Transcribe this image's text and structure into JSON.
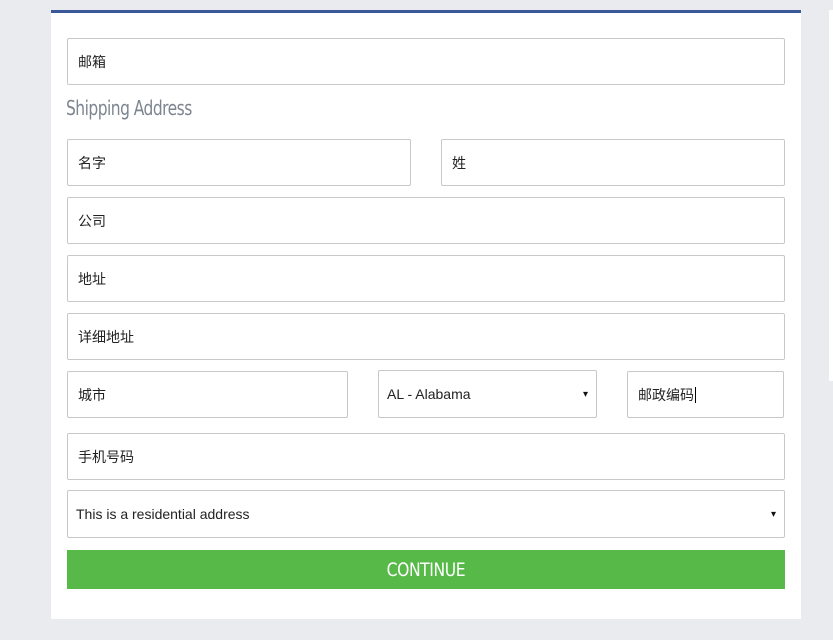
{
  "form": {
    "email_placeholder": "邮箱",
    "section_title": "Shipping Address",
    "first_name_placeholder": "名字",
    "last_name_placeholder": "姓",
    "company_placeholder": "公司",
    "address_placeholder": "地址",
    "address2_placeholder": "详细地址",
    "city_placeholder": "城市",
    "state_selected": "AL - Alabama",
    "zip_value": "邮政编码",
    "phone_placeholder": "手机号码",
    "address_type_selected": "This is a residential address",
    "continue_label": "CONTINUE"
  },
  "icons": {
    "dropdown_arrow": "▾"
  }
}
